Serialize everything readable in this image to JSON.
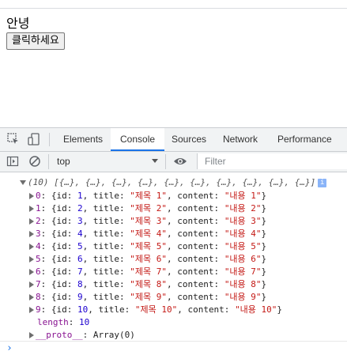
{
  "page": {
    "greeting": "안녕",
    "button_label": "클릭하세요"
  },
  "devtools": {
    "tabs": [
      "Elements",
      "Console",
      "Sources",
      "Network",
      "Performance"
    ],
    "active_tab": "Console",
    "context": "top",
    "filter_placeholder": "Filter",
    "icons": [
      "inspect-element-icon",
      "device-toggle-icon",
      "sidebar-toggle-icon",
      "clear-console-icon",
      "eye-icon",
      "info-icon"
    ]
  },
  "console": {
    "array_header_count": "(10)",
    "array_preview": "[{…}, {…}, {…}, {…}, {…}, {…}, {…}, {…}, {…}, {…}]",
    "items": [
      {
        "index": "0",
        "id": "1",
        "title": "\"제목 1\"",
        "content": "\"내용 1\""
      },
      {
        "index": "1",
        "id": "2",
        "title": "\"제목 2\"",
        "content": "\"내용 2\""
      },
      {
        "index": "2",
        "id": "3",
        "title": "\"제목 3\"",
        "content": "\"내용 3\""
      },
      {
        "index": "3",
        "id": "4",
        "title": "\"제목 4\"",
        "content": "\"내용 4\""
      },
      {
        "index": "4",
        "id": "5",
        "title": "\"제목 5\"",
        "content": "\"내용 5\""
      },
      {
        "index": "5",
        "id": "6",
        "title": "\"제목 6\"",
        "content": "\"내용 6\""
      },
      {
        "index": "6",
        "id": "7",
        "title": "\"제목 7\"",
        "content": "\"내용 7\""
      },
      {
        "index": "7",
        "id": "8",
        "title": "\"제목 8\"",
        "content": "\"내용 8\""
      },
      {
        "index": "8",
        "id": "9",
        "title": "\"제목 9\"",
        "content": "\"내용 9\""
      },
      {
        "index": "9",
        "id": "10",
        "title": "\"제목 10\"",
        "content": "\"내용 10\""
      }
    ],
    "length_key": "length",
    "length_value": "10",
    "proto_key": "__proto__",
    "proto_value": "Array(0)",
    "prompt": "›"
  }
}
